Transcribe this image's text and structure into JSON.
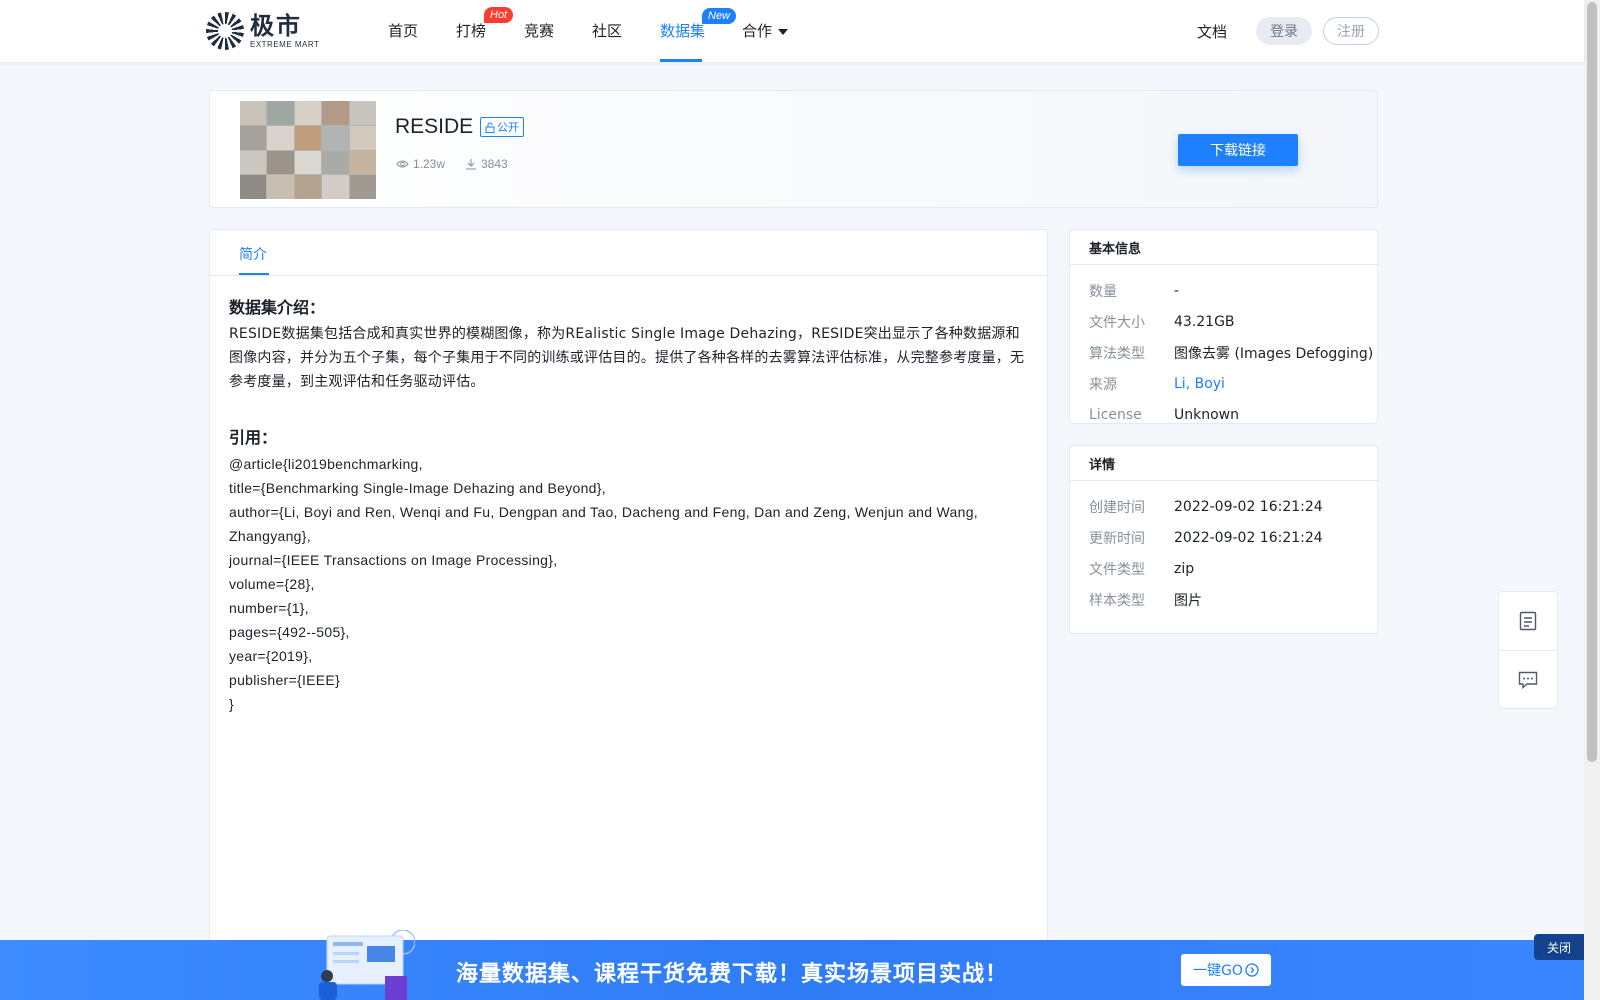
{
  "brand": {
    "name_cn": "极市",
    "name_en": "EXTREME MART"
  },
  "nav": {
    "items": [
      {
        "label": "首页"
      },
      {
        "label": "打榜",
        "badge": "Hot"
      },
      {
        "label": "竞赛"
      },
      {
        "label": "社区"
      },
      {
        "label": "数据集",
        "badge": "New",
        "active": true
      },
      {
        "label": "合作"
      }
    ],
    "docs": "文档",
    "login": "登录",
    "register": "注册"
  },
  "dataset": {
    "title": "RESIDE",
    "visibility": "公开",
    "views": "1.23w",
    "downloads": "3843",
    "download_button": "下载链接"
  },
  "tabs": [
    {
      "label": "简介",
      "active": true
    }
  ],
  "intro": {
    "heading": "数据集介绍：",
    "text": "RESIDE数据集包括合成和真实世界的模糊图像，称为REalistic Single Image Dehazing，RESIDE突出显示了各种数据源和图像内容，并分为五个子集，每个子集用于不同的训练或评估目的。提供了各种各样的去雾算法评估标准，从完整参考度量，无参考度量，到主观评估和任务驱动评估。"
  },
  "citation": {
    "heading": "引用：",
    "lines": [
      "@article{li2019benchmarking,",
      "title={Benchmarking Single-Image Dehazing and Beyond},",
      "author={Li, Boyi and Ren, Wenqi and Fu, Dengpan and Tao, Dacheng and Feng, Dan and Zeng, Wenjun and Wang, Zhangyang},",
      "journal={IEEE Transactions on Image Processing},",
      "volume={28},",
      "number={1},",
      "pages={492--505},",
      "year={2019},",
      "publisher={IEEE}",
      "}"
    ]
  },
  "basic_info": {
    "title": "基本信息",
    "rows": [
      {
        "label": "数量",
        "value": "-"
      },
      {
        "label": "文件大小",
        "value": "43.21GB"
      },
      {
        "label": "算法类型",
        "value": "图像去雾 (Images Defogging)"
      },
      {
        "label": "来源",
        "value": "Li, Boyi"
      },
      {
        "label": "License",
        "value": "Unknown"
      }
    ]
  },
  "details": {
    "title": "详情",
    "rows": [
      {
        "label": "创建时间",
        "value": "2022-09-02 16:21:24"
      },
      {
        "label": "更新时间",
        "value": "2022-09-02 16:21:24"
      },
      {
        "label": "文件类型",
        "value": "zip"
      },
      {
        "label": "样本类型",
        "value": "图片"
      }
    ]
  },
  "banner": {
    "text": "海量数据集、课程干货免费下载！真实场景项目实战！",
    "button": "一键GO",
    "close": "关闭"
  },
  "colors": {
    "accent": "#1e80ff",
    "hot": "#ff3b30",
    "banner": "#2f7cf6"
  }
}
